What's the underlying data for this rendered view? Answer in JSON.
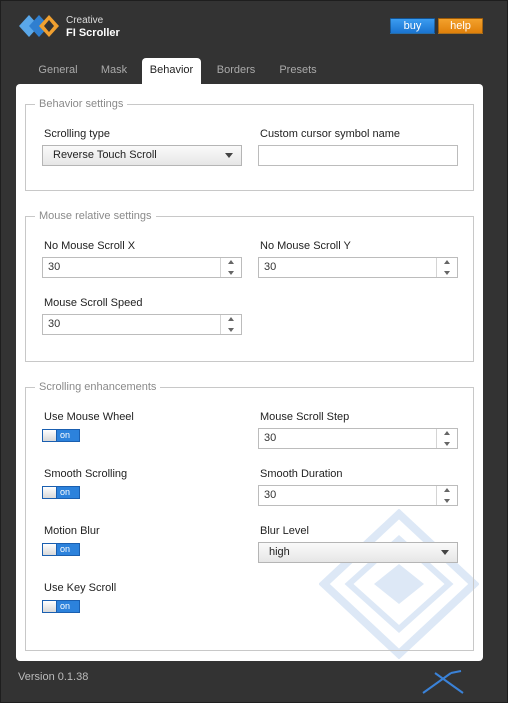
{
  "header": {
    "brand_top": "Creative",
    "brand_bottom": "FI Scroller",
    "buy_label": "buy",
    "help_label": "help"
  },
  "tabs": [
    {
      "label": "General",
      "active": false
    },
    {
      "label": "Mask",
      "active": false
    },
    {
      "label": "Behavior",
      "active": true
    },
    {
      "label": "Borders",
      "active": false
    },
    {
      "label": "Presets",
      "active": false
    }
  ],
  "behavior_settings": {
    "legend": "Behavior settings",
    "scrolling_type_label": "Scrolling type",
    "scrolling_type_value": "Reverse Touch Scroll",
    "cursor_symbol_label": "Custom cursor symbol name",
    "cursor_symbol_value": ""
  },
  "mouse_relative": {
    "legend": "Mouse relative settings",
    "no_scroll_x_label": "No Mouse Scroll X",
    "no_scroll_x_value": "30",
    "no_scroll_y_label": "No Mouse Scroll Y",
    "no_scroll_y_value": "30",
    "scroll_speed_label": "Mouse Scroll Speed",
    "scroll_speed_value": "30"
  },
  "enhancements": {
    "legend": "Scrolling enhancements",
    "mouse_wheel_label": "Use Mouse Wheel",
    "mouse_wheel_toggle": "on",
    "smooth_scrolling_label": "Smooth Scrolling",
    "smooth_scrolling_toggle": "on",
    "motion_blur_label": "Motion Blur",
    "motion_blur_toggle": "on",
    "key_scroll_label": "Use Key Scroll",
    "key_scroll_toggle": "on",
    "scroll_step_label": "Mouse Scroll Step",
    "scroll_step_value": "30",
    "smooth_duration_label": "Smooth Duration",
    "smooth_duration_value": "30",
    "blur_level_label": "Blur Level",
    "blur_level_value": "high"
  },
  "footer": {
    "version": "Version 0.1.38"
  },
  "colors": {
    "window_bg": "#333333",
    "accent_blue": "#1a74d0",
    "accent_orange": "#e0800a",
    "toggle_on": "#2c82dc"
  }
}
